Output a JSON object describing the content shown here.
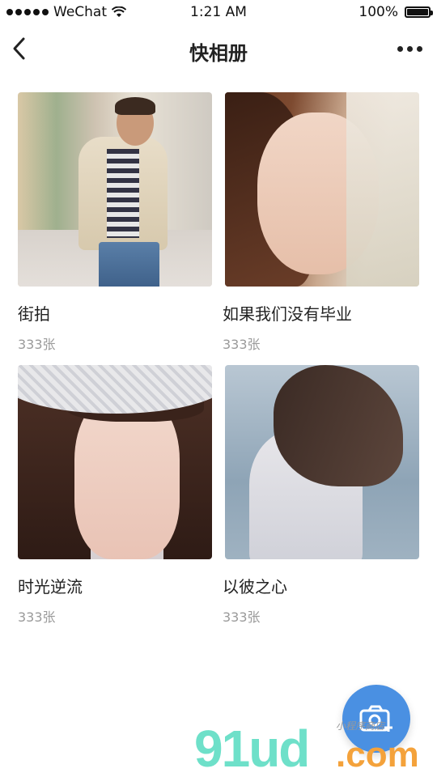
{
  "status_bar": {
    "carrier": "WeChat",
    "time": "1:21 AM",
    "battery": "100%"
  },
  "nav": {
    "title": "快相册",
    "back_icon": "chevron-left-icon",
    "more_icon": "more-horizontal-icon"
  },
  "albums": [
    {
      "name": "街拍",
      "count": "333张"
    },
    {
      "name": "如果我们没有毕业",
      "count": "333张"
    },
    {
      "name": "时光逆流",
      "count": "333张"
    },
    {
      "name": "以彼之心",
      "count": "333张"
    }
  ],
  "fab": {
    "icon": "camera-plus-icon",
    "color": "#4a90e2"
  },
  "watermark": {
    "text": "91ud",
    "suffix": ".com",
    "small": "小程序商店"
  }
}
